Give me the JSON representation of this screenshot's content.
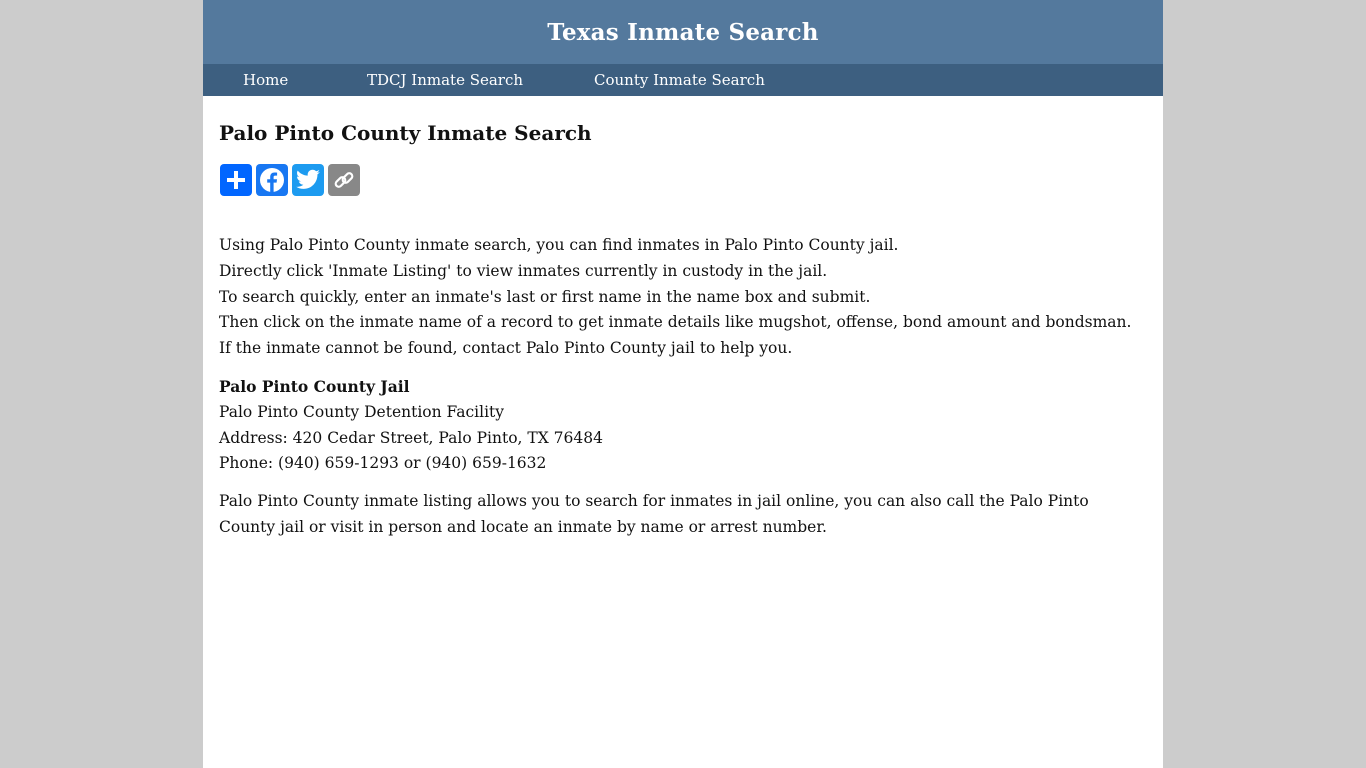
{
  "header": {
    "site_title": "Texas Inmate Search"
  },
  "nav": {
    "items": [
      {
        "label": "Home"
      },
      {
        "label": "TDCJ Inmate Search"
      },
      {
        "label": "County Inmate Search"
      }
    ]
  },
  "main": {
    "page_title": "Palo Pinto County Inmate Search",
    "share_buttons": [
      {
        "icon": "plus-icon",
        "color": "#0166ff"
      },
      {
        "icon": "facebook-icon",
        "color": "#1877f2"
      },
      {
        "icon": "twitter-icon",
        "color": "#1d9bf0"
      },
      {
        "icon": "link-icon",
        "color": "#888888"
      }
    ],
    "intro_lines": [
      "Using Palo Pinto County inmate search, you can find inmates in Palo Pinto County jail.",
      "Directly click 'Inmate Listing' to view inmates currently in custody in the jail.",
      "To search quickly, enter an inmate's last or first name in the name box and submit.",
      "Then click on the inmate name of a record to get inmate details like mugshot, offense, bond amount and bondsman.",
      "If the inmate cannot be found, contact Palo Pinto County jail to help you."
    ],
    "jail": {
      "heading": "Palo Pinto County Jail",
      "facility": "Palo Pinto County Detention Facility",
      "address": "Address: 420 Cedar Street, Palo Pinto, TX 76484",
      "phone": "Phone: (940) 659-1293 or (940) 659-1632"
    },
    "outro": "Palo Pinto County inmate listing allows you to search for inmates in jail online, you can also call the Palo Pinto County jail or visit in person and locate an inmate by name or arrest number."
  },
  "colors": {
    "header_bg": "#54799d",
    "nav_bg": "#3d5f80",
    "page_bg": "#cccccc"
  }
}
